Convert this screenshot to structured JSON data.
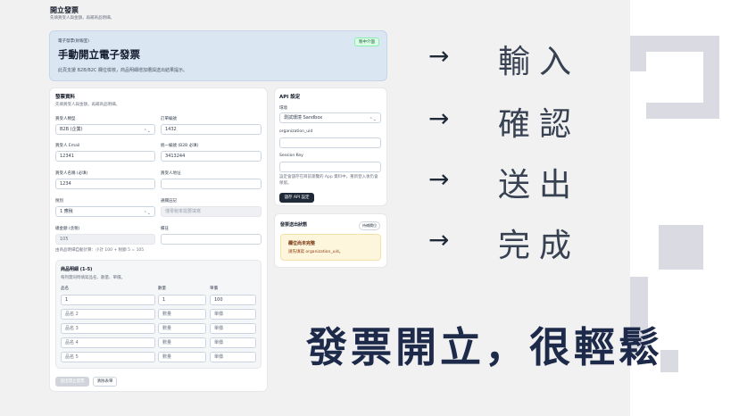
{
  "page": {
    "title": "開立發票",
    "subtitle": "先填買受人與金額，再補商品明細。"
  },
  "hero": {
    "eyebrow": "電子發票(財報室)",
    "title": "手動開立電子發票",
    "description": "此頁支援 B2B/B2C 欄位檢核，商品明細增加槽與送出結果提示。",
    "badge": "製中介面"
  },
  "invoice_form": {
    "title": "發票資料",
    "hint": "先填買受人與金額，再補商品明細。",
    "buyer_type": {
      "label": "買受人類型",
      "value": "B2B (企業)"
    },
    "order_no": {
      "label": "訂單編號",
      "value": "1432"
    },
    "buyer_email": {
      "label": "買受人 Email",
      "value": "12341"
    },
    "tax_id": {
      "label": "統一編號 (B2B 必填)",
      "value": "3413244"
    },
    "buyer_name": {
      "label": "買受人名稱 (必填)",
      "value": "1234"
    },
    "buyer_address": {
      "label": "買受人地址",
      "value": ""
    },
    "tax_type": {
      "label": "稅別",
      "value": "1 應稅"
    },
    "carrier": {
      "label": "通關註記",
      "placeholder": "僅零稅率需要填寫"
    },
    "total": {
      "label": "總金額 (含稅)",
      "value": "105"
    },
    "note": {
      "label": "備註",
      "value": ""
    },
    "calc_note": "由商品明細自動計算：小計 100 + 稅額 5 = 105"
  },
  "items_panel": {
    "title": "商品明細 (1-5)",
    "hint": "每列需同時填寫品名、數量、單價。",
    "headers": {
      "name": "品名",
      "qty": "數量",
      "price": "單價"
    },
    "rows": [
      {
        "name": "1",
        "qty": "1",
        "price": "100"
      },
      {
        "name": "品名 2",
        "qty": "數量",
        "price": "單價"
      },
      {
        "name": "品名 3",
        "qty": "數量",
        "price": "單價"
      },
      {
        "name": "品名 4",
        "qty": "數量",
        "price": "單價"
      },
      {
        "name": "品名 5",
        "qty": "數量",
        "price": "單價"
      }
    ]
  },
  "actions": {
    "submit": "送出開立發票",
    "clear": "清除表單"
  },
  "api_settings": {
    "title": "API 設定",
    "env": {
      "label": "環境",
      "value": "測試環境 Sandbox"
    },
    "org_uid": {
      "label": "organization_uid",
      "value": ""
    },
    "session_key": {
      "label": "Session Key",
      "value": ""
    },
    "hint": "設定會儲存在目前瀏覽的 App 資料中，重新登入後仍會保留。",
    "save": "儲存 API 設定"
  },
  "send_status": {
    "title": "發票送出狀態",
    "badge": "待補欄位",
    "warn_title": "欄位尚未完整",
    "warn_desc": "請先填寫 organization_uid。"
  },
  "steps": [
    {
      "arrow": "→",
      "label": "輸入"
    },
    {
      "arrow": "→",
      "label": "確認"
    },
    {
      "arrow": "→",
      "label": "送出"
    },
    {
      "arrow": "→",
      "label": "完成"
    }
  ],
  "slogan": "發票開立，很輕鬆",
  "colors": {
    "hero_bg": "#dbe6f3",
    "badge_green": "#166534",
    "warn_bg": "#fdf5dc",
    "slogan": "#1e2a4a"
  }
}
